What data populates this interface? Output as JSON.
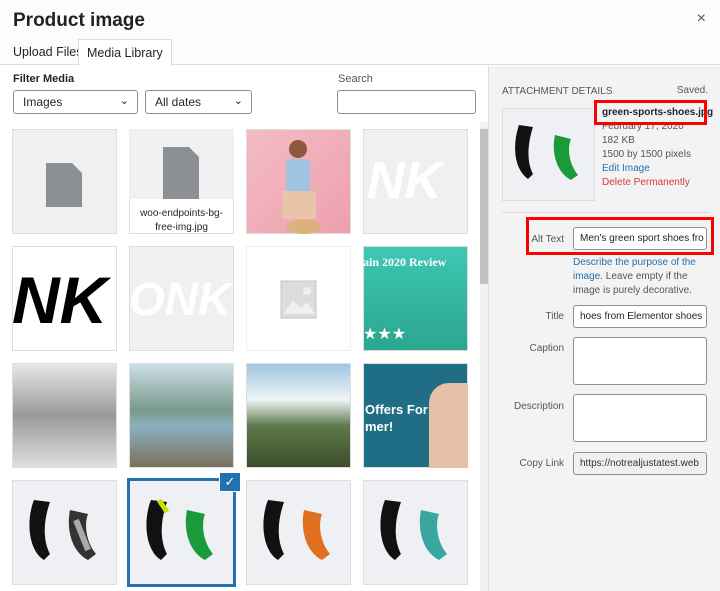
{
  "modal": {
    "title": "Product image",
    "close": "×"
  },
  "tabs": [
    {
      "label": "Upload Files"
    },
    {
      "label": "Media Library"
    }
  ],
  "filter": {
    "label": "Filter Media",
    "type": "Images",
    "date": "All dates",
    "search_label": "Search",
    "search_value": ""
  },
  "grid": {
    "file_name": "woo-endpoints-bg-free-img.jpg",
    "review_text": "ain 2020 Review",
    "offers_text": "Offers For",
    "offers_text2": "mer!",
    "stars": "★★★",
    "dnk": "NK"
  },
  "details": {
    "heading": "ATTACHMENT DETAILS",
    "status": "Saved.",
    "filename": "green-sports-shoes.jpg",
    "date": "February 17, 2020",
    "size": "182 KB",
    "dimensions": "1500 by 1500 pixels",
    "edit": "Edit Image",
    "delete": "Delete Permanently",
    "alt_label": "Alt Text",
    "alt_value": "Men's green sport shoes fro",
    "alt_help_link": "Describe the purpose of the image",
    "alt_help": ". Leave empty if the image is purely decorative.",
    "title_label": "Title",
    "title_value": "hoes from Elementor shoes",
    "caption_label": "Caption",
    "description_label": "Description",
    "copy_label": "Copy Link",
    "copy_value": "https://notrealjustatest.web"
  }
}
